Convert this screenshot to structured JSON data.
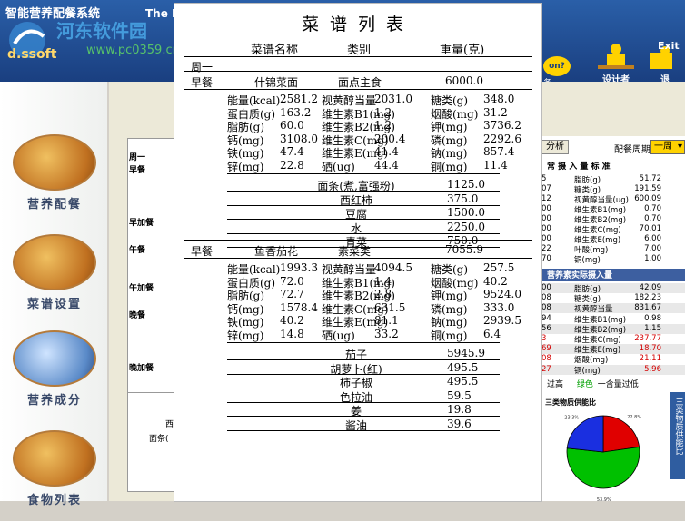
{
  "app": {
    "title": "智能营养配餐系统",
    "title_en": "The I",
    "watermark_cn": "河东软件园",
    "watermark_url": "www.pc0359.cn",
    "soft_label": "d.ssoft",
    "top_buttons": [
      {
        "label": "设计者"
      },
      {
        "label": "退"
      }
    ],
    "exit_label": "Exit",
    "question_label": "on?",
    "wu_label": "务"
  },
  "nav": {
    "items": [
      {
        "label": "营养配餐"
      },
      {
        "label": "菜谱设置"
      },
      {
        "label": "营养成分"
      },
      {
        "label": "食物列表"
      }
    ]
  },
  "background": {
    "day_label": "周一",
    "rows": [
      "早餐",
      "早加餐",
      "午餐",
      "午加餐",
      "晚餐",
      "晚加餐"
    ],
    "bottom_label1": "面条(",
    "bottom_label2": "西"
  },
  "right_panel": {
    "analysis_button": "分析",
    "cycle_label": "配餐周期",
    "cycle_value": "一周",
    "std_title": "常 摄 入 量 标 准",
    "std_rows": [
      {
        "k": "5",
        "n": "脂肪(g)",
        "v": "51.72"
      },
      {
        "k": "07",
        "n": "糖类(g)",
        "v": "191.59"
      },
      {
        "k": "12",
        "n": "视黄醇当量(ug)",
        "v": "600.09"
      },
      {
        "k": "00",
        "n": "维生素B1(mg)",
        "v": "0.70"
      },
      {
        "k": "00",
        "n": "维生素B2(mg)",
        "v": "0.70"
      },
      {
        "k": "00",
        "n": "维生素C(mg)",
        "v": "70.01"
      },
      {
        "k": "00",
        "n": "维生素E(mg)",
        "v": "6.00"
      },
      {
        "k": "22",
        "n": "叶酸(mg)",
        "v": "7.00"
      },
      {
        "k": "70",
        "n": "铜(mg)",
        "v": "1.00"
      }
    ],
    "actual_title": "营养素实际摄入量",
    "actual_rows": [
      {
        "k": "00",
        "n": "脂肪(g)",
        "v": "42.09",
        "c": "#000000"
      },
      {
        "k": "08",
        "n": "糖类(g)",
        "v": "182.23",
        "c": "#000000"
      },
      {
        "k": "08",
        "n": "视黄醇当量",
        "v": "831.67",
        "c": "#000000"
      },
      {
        "k": "94",
        "n": "维生素B1(mg)",
        "v": "0.98",
        "c": "#000000"
      },
      {
        "k": "56",
        "n": "维生素B2(mg)",
        "v": "1.15",
        "c": "#000000"
      },
      {
        "k": "3",
        "n": "维生素C(mg)",
        "v": "237.77",
        "c": "#d40000"
      },
      {
        "k": "69",
        "n": "维生素E(mg)",
        "v": "18.70",
        "c": "#d40000"
      },
      {
        "k": "08",
        "n": "烟酸(mg)",
        "v": "21.11",
        "c": "#d40000"
      },
      {
        "k": "27",
        "n": "铜(mg)",
        "v": "5.96",
        "c": "#d40000"
      }
    ],
    "legend_high": "过高",
    "legend_green": "绿色",
    "legend_low": "一含量过低",
    "pie_title": "三类物质供能比",
    "pie_slices": [
      {
        "label": "22.8%",
        "value": 22.8,
        "color": "#e00000"
      },
      {
        "label": "53.9%",
        "value": 53.9,
        "color": "#00c000"
      },
      {
        "label": "23.3%",
        "value": 23.3,
        "color": "#1a2fe0"
      }
    ],
    "side_tab": "三类物质供能比"
  },
  "sheet": {
    "title": "菜谱列表",
    "col_dish": "菜谱名称",
    "col_category": "类别",
    "col_weight": "重量(克)",
    "week": "周一",
    "blocks": [
      {
        "meal": "早餐",
        "dish": "什锦菜面",
        "category": "面点主食",
        "weight": "6000.0",
        "nutrients": [
          [
            "能量(kcal)",
            "2581.2",
            "视黄醇当量",
            "2031.0",
            "糖类(g)",
            "348.0"
          ],
          [
            "蛋白质(g)",
            "163.2",
            "维生素B1(mg)",
            "1.2",
            "烟酸(mg)",
            "31.2"
          ],
          [
            "脂肪(g)",
            "60.0",
            "维生素B2(mg)",
            "1.2",
            "钾(mg)",
            "3736.2"
          ],
          [
            "钙(mg)",
            "3108.0",
            "维生素C(mg)",
            "200.4",
            "磷(mg)",
            "2292.6"
          ],
          [
            "铁(mg)",
            "47.4",
            "维生素E(mg)",
            "41.4",
            "钠(mg)",
            "857.4"
          ],
          [
            "锌(mg)",
            "22.8",
            "硒(ug)",
            "44.4",
            "铜(mg)",
            "11.4"
          ]
        ],
        "ingredients": [
          [
            "面条(煮,富强粉)",
            "1125.0"
          ],
          [
            "西红柿",
            "375.0"
          ],
          [
            "豆腐",
            "1500.0"
          ],
          [
            "水",
            "2250.0"
          ],
          [
            "青菜",
            "750.0"
          ]
        ]
      },
      {
        "meal": "早餐",
        "dish": "鱼香茄花",
        "category": "素菜类",
        "weight": "7055.9",
        "nutrients": [
          [
            "能量(kcal)",
            "1993.3",
            "视黄醇当量",
            "4094.5",
            "糖类(g)",
            "257.5"
          ],
          [
            "蛋白质(g)",
            "72.0",
            "维生素B1(mg)",
            "1.4",
            "烟酸(mg)",
            "40.2"
          ],
          [
            "脂肪(g)",
            "72.7",
            "维生素B2(mg)",
            "2.8",
            "钾(mg)",
            "9524.0"
          ],
          [
            "钙(mg)",
            "1578.4",
            "维生素C(mg)",
            "631.5",
            "磷(mg)",
            "333.0"
          ],
          [
            "铁(mg)",
            "40.2",
            "维生素E(mg)",
            "81.1",
            "钠(mg)",
            "2939.5"
          ],
          [
            "锌(mg)",
            "14.8",
            "硒(ug)",
            "33.2",
            "铜(mg)",
            "6.4"
          ]
        ],
        "ingredients": [
          [
            "茄子",
            "5945.9"
          ],
          [
            "胡萝卜(红)",
            "495.5"
          ],
          [
            "柿子椒",
            "495.5"
          ],
          [
            "色拉油",
            "59.5"
          ],
          [
            "姜",
            "19.8"
          ],
          [
            "酱油",
            "39.6"
          ]
        ]
      }
    ]
  }
}
